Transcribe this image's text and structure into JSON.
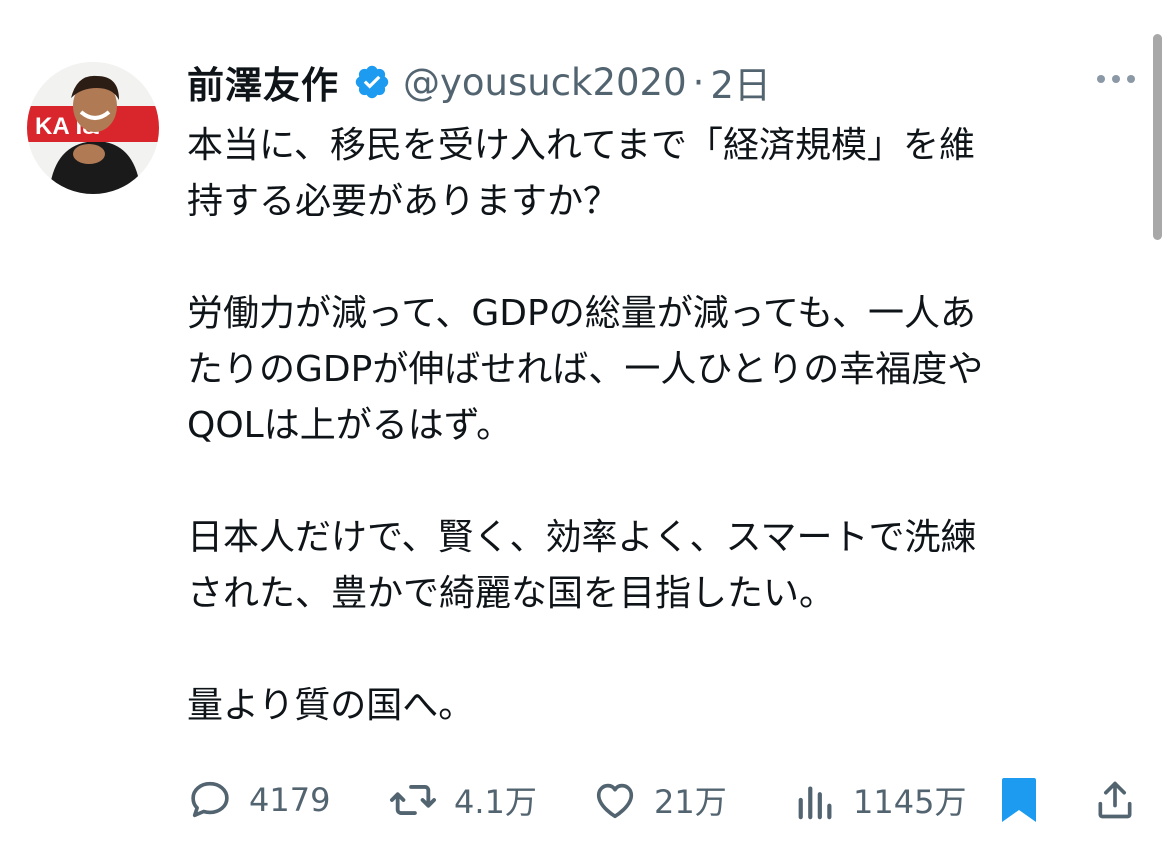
{
  "author": {
    "display_name": "前澤友作",
    "handle": "@yousuck2020",
    "separator": "·",
    "time": "2日",
    "verified_color": "#1d9bf0",
    "avatar_banner_text": "KA  I&"
  },
  "tweet": {
    "paragraphs": [
      "本当に、移民を受け入れてまで「経済規模」を維\n持する必要がありますか？",
      "労働力が減って、GDPの総量が減っても、一人あ\nたりのGDPが伸ばせれば、一人ひとりの幸福度や\nQOLは上がるはず。",
      "日本人だけで、賢く、効率よく、スマートで洗練\nされた、豊かで綺麗な国を目指したい。",
      "量より質の国へ。"
    ]
  },
  "actions": {
    "reply": {
      "icon": "reply-icon",
      "count": "4179"
    },
    "retweet": {
      "icon": "retweet-icon",
      "count": "4.1万"
    },
    "like": {
      "icon": "heart-icon",
      "count": "21万"
    },
    "views": {
      "icon": "views-icon",
      "count": "1145万"
    },
    "bookmark": {
      "icon": "bookmark-icon",
      "color": "#1d9bf0"
    },
    "share": {
      "icon": "share-icon"
    }
  },
  "colors": {
    "text": "#0f1419",
    "secondary": "#536471",
    "accent": "#1d9bf0"
  }
}
